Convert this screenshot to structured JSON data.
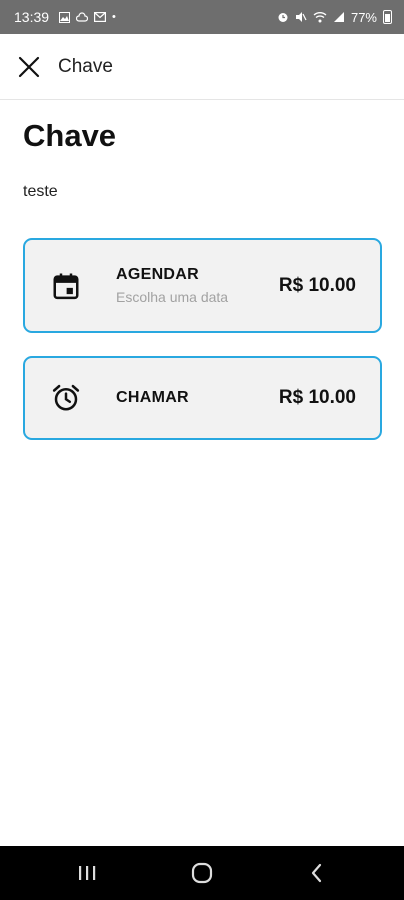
{
  "status_bar": {
    "time": "13:39",
    "left_icons": [
      "gallery-icon",
      "cloud-icon",
      "mail-icon"
    ],
    "dot": "•",
    "right_icons": [
      "alarm-icon",
      "mute-icon",
      "wifi-icon",
      "signal-icon"
    ],
    "battery": "77%"
  },
  "app_bar": {
    "title": "Chave",
    "close_icon": "close-icon"
  },
  "page": {
    "title": "Chave",
    "description": "teste"
  },
  "options": [
    {
      "icon": "calendar-icon",
      "label": "AGENDAR",
      "sublabel": "Escolha uma data",
      "price": "R$ 10.00"
    },
    {
      "icon": "alarm-clock-icon",
      "label": "CHAMAR",
      "price": "R$ 10.00"
    }
  ],
  "nav_bar": {
    "buttons": [
      "recent-apps-icon",
      "home-icon",
      "back-icon"
    ]
  },
  "colors": {
    "status_bar_bg": "#6e6e6e",
    "card_border": "#29a8e0",
    "card_bg": "#f2f2f2",
    "nav_bar_bg": "#000000"
  }
}
